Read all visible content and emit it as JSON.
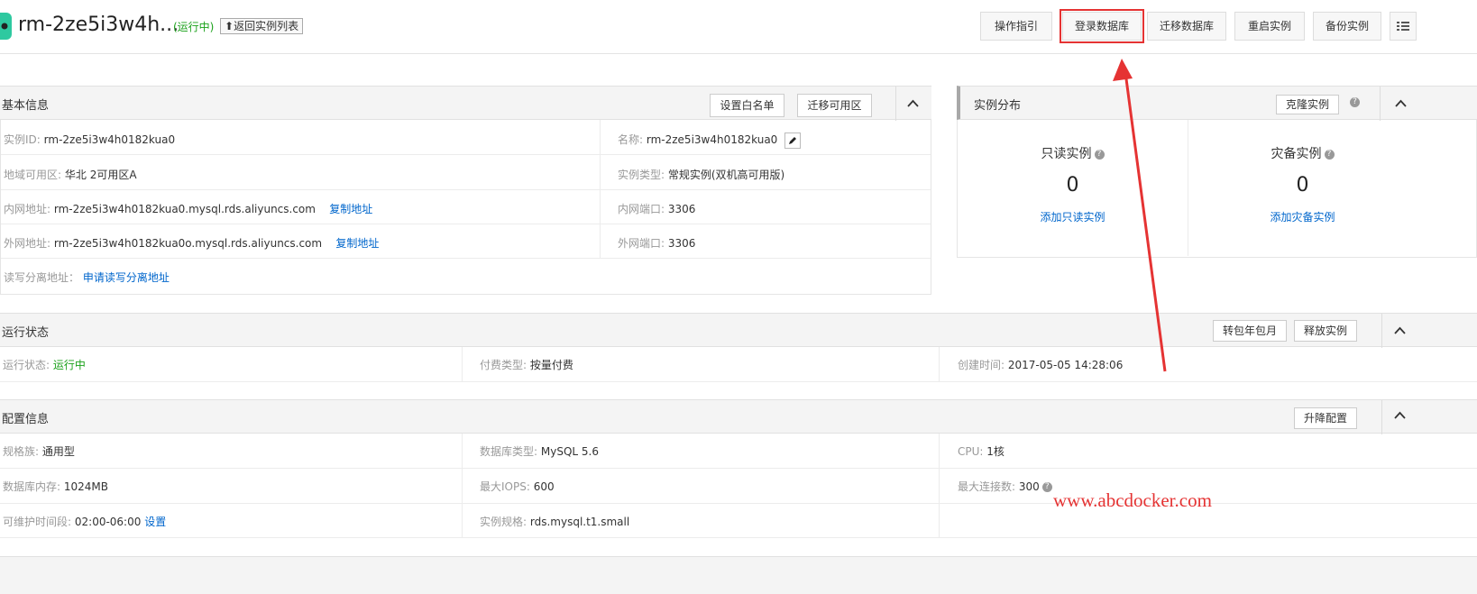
{
  "header": {
    "instance_title": "rm-2ze5i3w4h...",
    "status": "(运行中)",
    "back_label": "返回实例列表",
    "buttons": [
      "操作指引",
      "登录数据库",
      "迁移数据库",
      "重启实例",
      "备份实例"
    ]
  },
  "basic_info": {
    "title": "基本信息",
    "buttons": [
      "设置白名单",
      "迁移可用区"
    ],
    "instance_id_label": "实例ID:",
    "instance_id": "rm-2ze5i3w4h0182kua0",
    "name_label": "名称:",
    "name": "rm-2ze5i3w4h0182kua0",
    "region_label": "地域可用区:",
    "region": "华北 2可用区A",
    "type_label": "实例类型:",
    "type": "常规实例(双机高可用版)",
    "intranet_label": "内网地址:",
    "intranet": "rm-2ze5i3w4h0182kua0.mysql.rds.aliyuncs.com",
    "copy_label": "复制地址",
    "intranet_port_label": "内网端口:",
    "intranet_port": "3306",
    "internet_label": "外网地址:",
    "internet": "rm-2ze5i3w4h0182kua0o.mysql.rds.aliyuncs.com",
    "internet_port_label": "外网端口:",
    "internet_port": "3306",
    "rw_split_label": "读写分离地址：",
    "rw_split_link": "申请读写分离地址"
  },
  "distribution": {
    "title": "实例分布",
    "clone_label": "克隆实例",
    "readonly_label": "只读实例",
    "readonly_count": "0",
    "readonly_link": "添加只读实例",
    "disaster_label": "灾备实例",
    "disaster_count": "0",
    "disaster_link": "添加灾备实例"
  },
  "run_status": {
    "title": "运行状态",
    "buttons": [
      "转包年包月",
      "释放实例"
    ],
    "status_label": "运行状态:",
    "status": "运行中",
    "billing_label": "付费类型:",
    "billing": "按量付费",
    "created_label": "创建时间:",
    "created": "2017-05-05 14:28:06"
  },
  "config": {
    "title": "配置信息",
    "button": "升降配置",
    "family_label": "规格族:",
    "family": "通用型",
    "dbtype_label": "数据库类型:",
    "dbtype": "MySQL 5.6",
    "cpu_label": "CPU:",
    "cpu": "1核",
    "memory_label": "数据库内存:",
    "memory": "1024MB",
    "iops_label": "最大IOPS:",
    "iops": "600",
    "conn_label": "最大连接数:",
    "conn": "300",
    "maint_label": "可维护时间段:",
    "maint": "02:00-06:00",
    "maint_link": "设置",
    "spec_label": "实例规格:",
    "spec": "rds.mysql.t1.small"
  },
  "watermark": "www.abcdocker.com",
  "colors": {
    "accent": "#0066cc",
    "running": "#1ba11b",
    "highlight": "#e53333"
  }
}
